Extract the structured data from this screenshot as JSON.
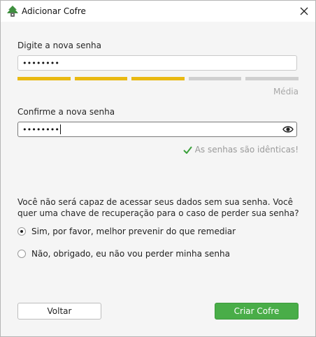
{
  "window": {
    "title": "Adicionar Cofre"
  },
  "new_password": {
    "label": "Digite a nova senha",
    "value": "••••••••",
    "strength_level": 3,
    "strength_total": 5,
    "strength_label": "Média"
  },
  "confirm_password": {
    "label": "Confirme a nova senha",
    "value": "••••••••",
    "match_text": "As senhas são idênticas!"
  },
  "recovery": {
    "question": "Você não será capaz de acessar seus dados sem sua senha. Você quer uma chave de recuperação para o caso de perder sua senha?",
    "options": [
      {
        "label": "Sim, por favor, melhor prevenir do que remediar",
        "selected": true
      },
      {
        "label": "Não, obrigado, eu não vou perder minha senha",
        "selected": false
      }
    ]
  },
  "buttons": {
    "back": "Voltar",
    "create": "Criar Cofre"
  },
  "colors": {
    "accent_green": "#49ad48",
    "strength_yellow": "#e9b912",
    "check_green": "#3aa03a"
  },
  "icons": [
    "vault-app-icon",
    "close-icon",
    "eye-icon",
    "check-icon"
  ]
}
